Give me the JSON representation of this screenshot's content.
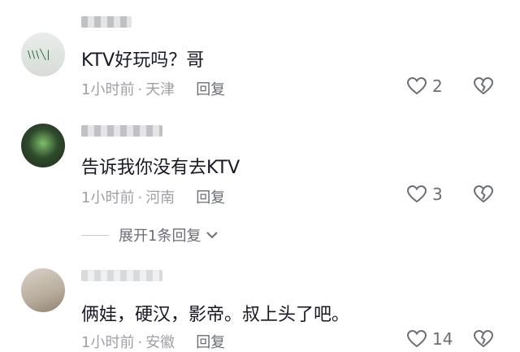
{
  "comments": [
    {
      "text": "KTV好玩吗？哥",
      "time": "1小时前",
      "location": "天津",
      "reply_label": "回复",
      "likes": "2"
    },
    {
      "text": "告诉我你没有去KTV",
      "time": "1小时前",
      "location": "河南",
      "reply_label": "回复",
      "likes": "3"
    },
    {
      "text": "俩娃，硬汉，影帝。叔上头了吧。",
      "time": "1小时前",
      "location": "安徽",
      "reply_label": "回复",
      "likes": "14"
    }
  ],
  "expand_replies": "展开1条回复",
  "separator": "·",
  "icons": {
    "like": "heart-outline-icon",
    "dislike": "broken-heart-icon",
    "expand": "chevron-down-icon"
  },
  "colors": {
    "text": "#161823",
    "meta": "#9ea0a6",
    "action": "#6b6e75"
  }
}
